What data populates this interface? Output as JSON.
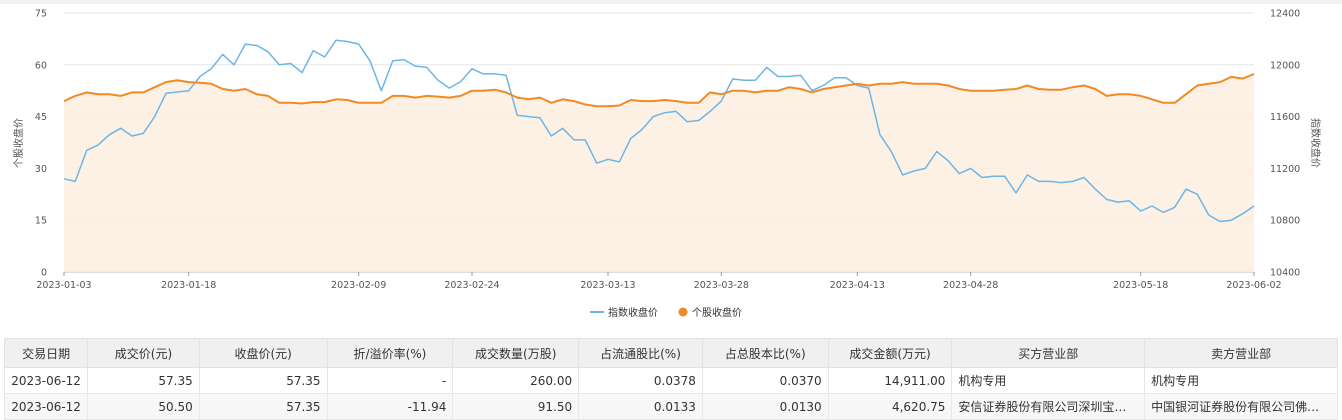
{
  "chart_data": {
    "type": "line",
    "x_ticks": [
      "2023-01-03",
      "2023-01-18",
      "2023-02-09",
      "2023-02-24",
      "2023-03-13",
      "2023-03-28",
      "2023-04-13",
      "2023-04-28",
      "2023-05-18",
      "2023-06-02"
    ],
    "y_left": {
      "label": "个股收盘价",
      "min": 0,
      "max": 75,
      "ticks": [
        0,
        15,
        30,
        45,
        60,
        75
      ]
    },
    "y_right": {
      "label": "指数收盘价",
      "min": 10400,
      "max": 12400,
      "ticks": [
        10400,
        10800,
        11200,
        11600,
        12000,
        12400
      ]
    },
    "series": [
      {
        "name": "指数收盘价",
        "axis": "right",
        "color": "#6cb6e6",
        "values": [
          11120,
          11100,
          11340,
          11380,
          11460,
          11510,
          11450,
          11470,
          11600,
          11780,
          11790,
          11800,
          11910,
          11970,
          12080,
          12000,
          12160,
          12150,
          12100,
          12000,
          12010,
          11940,
          12110,
          12060,
          12190,
          12180,
          12160,
          12030,
          11800,
          12030,
          12040,
          11990,
          11980,
          11880,
          11820,
          11870,
          11970,
          11930,
          11930,
          11920,
          11610,
          11600,
          11590,
          11450,
          11510,
          11420,
          11420,
          11240,
          11270,
          11250,
          11430,
          11500,
          11600,
          11630,
          11640,
          11560,
          11570,
          11640,
          11720,
          11890,
          11880,
          11880,
          11980,
          11910,
          11910,
          11920,
          11800,
          11840,
          11900,
          11900,
          11840,
          11820,
          11460,
          11330,
          11150,
          11180,
          11200,
          11330,
          11260,
          11160,
          11200,
          11130,
          11140,
          11140,
          11010,
          11150,
          11100,
          11100,
          11090,
          11100,
          11130,
          11040,
          10960,
          10940,
          10950,
          10870,
          10910,
          10860,
          10900,
          11040,
          11000,
          10840,
          10790,
          10800,
          10850,
          10910
        ],
        "source_hint": "approx 105 trading days"
      },
      {
        "name": "个股收盘价",
        "axis": "left",
        "color": "#f28a24",
        "values": [
          49.5,
          51.0,
          52.0,
          51.5,
          51.5,
          51.0,
          52.0,
          52.0,
          53.5,
          55.0,
          55.5,
          55.0,
          54.8,
          54.5,
          53.0,
          52.5,
          53.0,
          51.5,
          51.0,
          49.0,
          49.0,
          48.8,
          49.2,
          49.2,
          50.0,
          49.8,
          49.0,
          49.0,
          49.0,
          51.0,
          51.0,
          50.5,
          51.0,
          50.8,
          50.5,
          51.0,
          52.5,
          52.5,
          52.8,
          52.0,
          50.5,
          50.0,
          50.5,
          49.0,
          50.0,
          49.5,
          48.5,
          48.0,
          48.0,
          48.2,
          49.8,
          49.5,
          49.5,
          49.8,
          49.5,
          49.0,
          49.0,
          52.0,
          51.5,
          52.5,
          52.5,
          52.0,
          52.5,
          52.5,
          53.5,
          53.0,
          52.0,
          53.0,
          53.5,
          54.0,
          54.5,
          54.0,
          54.5,
          54.5,
          55.0,
          54.5,
          54.5,
          54.5,
          54.0,
          53.0,
          52.5,
          52.5,
          52.5,
          52.8,
          53.0,
          54.0,
          53.0,
          52.8,
          52.8,
          53.5,
          54.0,
          53.0,
          51.0,
          51.5,
          51.5,
          51.0,
          50.0,
          49.0,
          49.0,
          51.5,
          54.0,
          54.5,
          55.0,
          56.5,
          56.0,
          57.35
        ]
      }
    ],
    "legend": {
      "position": "bottom-center"
    }
  },
  "table": {
    "headers": [
      "交易日期",
      "成交价(元)",
      "收盘价(元)",
      "折/溢价率(%)",
      "成交数量(万股)",
      "占流通股比(%)",
      "占总股本比(%)",
      "成交金额(万元)",
      "买方营业部",
      "卖方营业部"
    ],
    "rows": [
      [
        "2023-06-12",
        "57.35",
        "57.35",
        "-",
        "260.00",
        "0.0378",
        "0.0370",
        "14,911.00",
        "机构专用",
        "机构专用"
      ],
      [
        "2023-06-12",
        "50.50",
        "57.35",
        "-11.94",
        "91.50",
        "0.0133",
        "0.0130",
        "4,620.75",
        "安信证券股份有限公司深圳宝安…",
        "中国银河证券股份有限公司佛山…"
      ]
    ]
  }
}
